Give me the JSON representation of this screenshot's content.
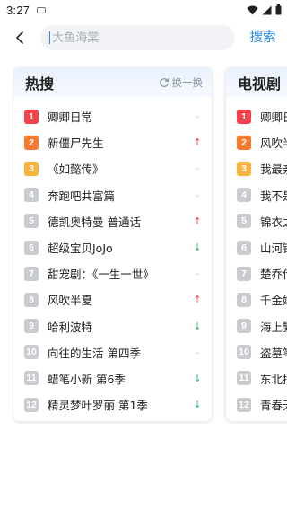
{
  "status_bar": {
    "time": "3:27"
  },
  "search": {
    "placeholder": "大鱼海棠",
    "button_label": "搜索"
  },
  "colors": {
    "rank_top1": "#f5424b",
    "rank_top2": "#fb7a2e",
    "rank_top3": "#f9b33a",
    "rank_other": "#c8cbd0",
    "trend_up": "#f5424b",
    "trend_down": "#3bb36c",
    "trend_flat": "#c5c9cf",
    "accent": "#2a8cf0"
  },
  "cards": [
    {
      "title": "热搜",
      "refresh_label": "换一换",
      "items": [
        {
          "rank": "1",
          "title": "卿卿日常",
          "trend": "flat"
        },
        {
          "rank": "2",
          "title": "新僵尸先生",
          "trend": "up"
        },
        {
          "rank": "3",
          "title": "《如懿传》",
          "trend": "flat"
        },
        {
          "rank": "4",
          "title": "奔跑吧共富篇",
          "trend": "flat"
        },
        {
          "rank": "5",
          "title": "德凯奥特曼 普通话",
          "trend": "up"
        },
        {
          "rank": "6",
          "title": "超级宝贝JoJo",
          "trend": "down"
        },
        {
          "rank": "7",
          "title": "甜宠剧：《一生一世》",
          "trend": "flat"
        },
        {
          "rank": "8",
          "title": "风吹半夏",
          "trend": "up"
        },
        {
          "rank": "9",
          "title": "哈利波特",
          "trend": "down"
        },
        {
          "rank": "10",
          "title": "向往的生活 第四季",
          "trend": "flat"
        },
        {
          "rank": "11",
          "title": "蜡笔小新 第6季",
          "trend": "down"
        },
        {
          "rank": "12",
          "title": "精灵梦叶罗丽 第1季",
          "trend": "down"
        }
      ]
    },
    {
      "title": "电视剧",
      "items": [
        {
          "rank": "1",
          "title": "卿卿日"
        },
        {
          "rank": "2",
          "title": "风吹半"
        },
        {
          "rank": "3",
          "title": "我最亲"
        },
        {
          "rank": "4",
          "title": "我不是"
        },
        {
          "rank": "5",
          "title": "锦衣之"
        },
        {
          "rank": "6",
          "title": "山河锦"
        },
        {
          "rank": "7",
          "title": "楚乔传"
        },
        {
          "rank": "8",
          "title": "千金嫁"
        },
        {
          "rank": "9",
          "title": "海上繁"
        },
        {
          "rank": "10",
          "title": "盗墓笔"
        },
        {
          "rank": "11",
          "title": "东北插"
        },
        {
          "rank": "12",
          "title": "青春无"
        }
      ]
    }
  ]
}
